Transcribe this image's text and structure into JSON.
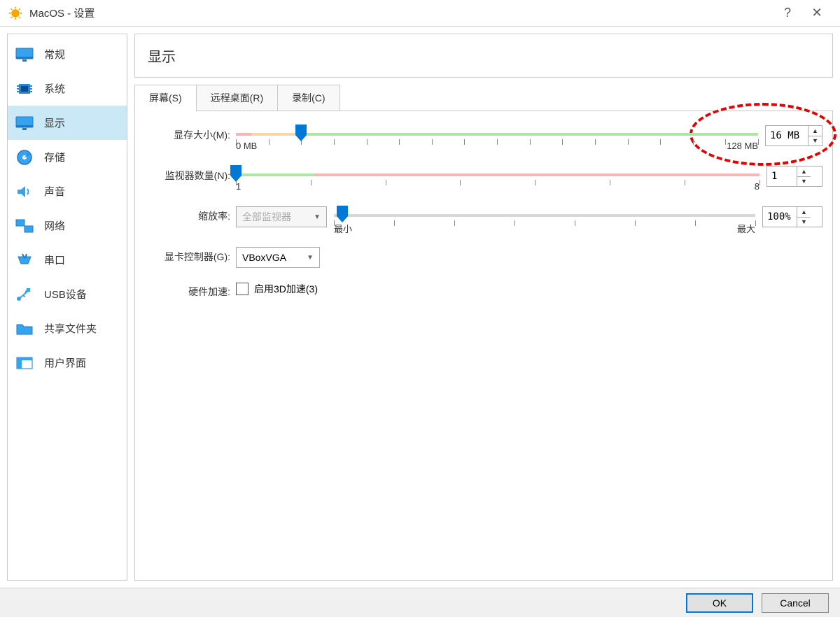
{
  "window": {
    "title": "MacOS - 设置",
    "help_symbol": "?",
    "close_symbol": "✕"
  },
  "sidebar": {
    "items": [
      {
        "label": "常规",
        "icon": "monitor"
      },
      {
        "label": "系统",
        "icon": "chip"
      },
      {
        "label": "显示",
        "icon": "monitor",
        "selected": true
      },
      {
        "label": "存储",
        "icon": "disk"
      },
      {
        "label": "声音",
        "icon": "speaker"
      },
      {
        "label": "网络",
        "icon": "network"
      },
      {
        "label": "串口",
        "icon": "serial"
      },
      {
        "label": "USB设备",
        "icon": "usb"
      },
      {
        "label": "共享文件夹",
        "icon": "folder"
      },
      {
        "label": "用户界面",
        "icon": "ui"
      }
    ]
  },
  "page": {
    "title": "显示"
  },
  "tabs": [
    {
      "label": "屏幕(S)",
      "active": true
    },
    {
      "label": "远程桌面(R)"
    },
    {
      "label": "录制(C)"
    }
  ],
  "screen_tab": {
    "video_memory": {
      "label": "显存大小(M):",
      "min_label": "0 MB",
      "max_label": "128 MB",
      "value": "16 MB",
      "thumb_pct": 12.5
    },
    "monitor_count": {
      "label": "监视器数量(N):",
      "min_label": "1",
      "max_label": "8",
      "value": "1",
      "thumb_pct": 0
    },
    "scale_factor": {
      "label": "缩放率:",
      "dropdown_value": "全部监视器",
      "min_label": "最小",
      "max_label": "最大",
      "value": "100%",
      "thumb_pct": 2
    },
    "gpu_controller": {
      "label": "显卡控制器(G):",
      "value": "VBoxVGA"
    },
    "hw_accel": {
      "label": "硬件加速:",
      "checkbox_label": "启用3D加速(3)",
      "checked": false
    }
  },
  "footer": {
    "ok": "OK",
    "cancel": "Cancel"
  }
}
